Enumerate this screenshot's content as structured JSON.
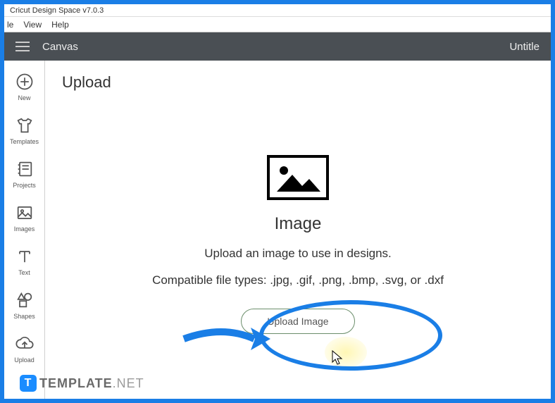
{
  "window": {
    "title": "Cricut Design Space  v7.0.3"
  },
  "menubar": {
    "file": "le",
    "view": "View",
    "help": "Help"
  },
  "appbar": {
    "title": "Canvas",
    "project": "Untitle"
  },
  "sidebar": {
    "items": [
      {
        "label": "New"
      },
      {
        "label": "Templates"
      },
      {
        "label": "Projects"
      },
      {
        "label": "Images"
      },
      {
        "label": "Text"
      },
      {
        "label": "Shapes"
      },
      {
        "label": "Upload"
      }
    ]
  },
  "main": {
    "page_title": "Upload",
    "image_heading": "Image",
    "image_sub": "Upload an image to use in designs.",
    "compat": "Compatible file types: .jpg, .gif, .png, .bmp, .svg, or .dxf",
    "upload_btn": "Upload Image"
  },
  "watermark": {
    "logo": "T",
    "bold": "TEMPLATE",
    "rest": ".NET"
  }
}
